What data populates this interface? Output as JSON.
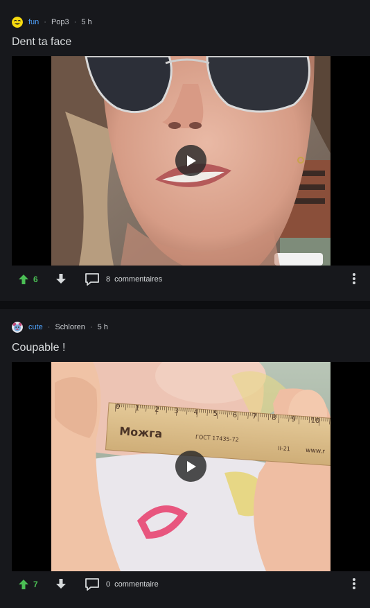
{
  "posts": [
    {
      "subreddit": "fun",
      "author": "Pop3",
      "age": "5 h",
      "title": "Dent ta face",
      "upvotes": "6",
      "comment_count": "8",
      "comment_label": "commentaires",
      "subreddit_icon": "smiley-face-icon"
    },
    {
      "subreddit": "cute",
      "author": "Schloren",
      "age": "5 h",
      "title": "Coupable !",
      "upvotes": "7",
      "comment_count": "0",
      "comment_label": "commentaire",
      "subreddit_icon": "bear-icon",
      "ruler_brand": "Можга",
      "ruler_standard": "ГОСТ 17435-72",
      "ruler_code": "II-21",
      "ruler_site": "www.r",
      "ruler_numbers": [
        "0",
        "1",
        "2",
        "3",
        "4",
        "5",
        "6",
        "7",
        "8",
        "9",
        "10",
        "11"
      ]
    }
  ],
  "colors": {
    "upvote": "#4bbf55",
    "subreddit_link": "#4fa3ff",
    "card_bg": "#17181c",
    "page_bg": "#0d0e11"
  }
}
